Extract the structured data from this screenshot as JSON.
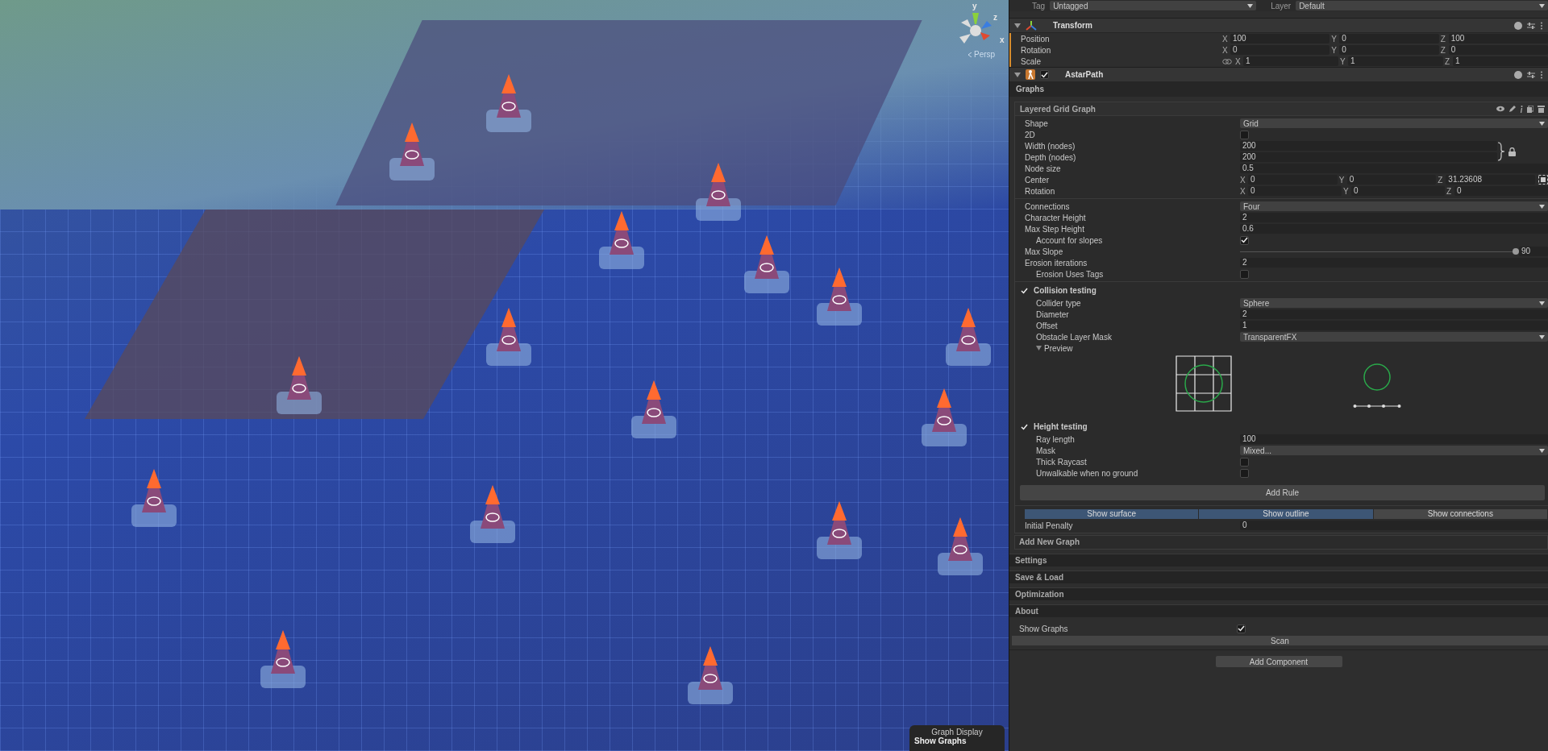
{
  "scene": {
    "gizmo": {
      "axes": [
        {
          "label": "y"
        },
        {
          "label": "z"
        },
        {
          "label": "x"
        }
      ],
      "projection": "Persp"
    },
    "overlay": {
      "title": "Graph Display",
      "item": "Show Graphs"
    }
  },
  "inspector": {
    "tag": {
      "label": "Tag",
      "value": "Untagged"
    },
    "layer": {
      "label": "Layer",
      "value": "Default"
    },
    "transform": {
      "title": "Transform",
      "expanded": true,
      "rows": [
        {
          "label": "Position",
          "fields": [
            {
              "axis": "X",
              "value": "100"
            },
            {
              "axis": "Y",
              "value": "0"
            },
            {
              "axis": "Z",
              "value": "100"
            }
          ]
        },
        {
          "label": "Rotation",
          "fields": [
            {
              "axis": "X",
              "value": "0"
            },
            {
              "axis": "Y",
              "value": "0"
            },
            {
              "axis": "Z",
              "value": "0"
            }
          ]
        },
        {
          "label": "Scale",
          "fields": [
            {
              "axis": "X",
              "value": "1"
            },
            {
              "axis": "Y",
              "value": "1"
            },
            {
              "axis": "Z",
              "value": "1"
            }
          ]
        }
      ]
    },
    "astar": {
      "title": "AstarPath",
      "enabled": true,
      "expanded": true,
      "section": "Graphs",
      "graph": {
        "title": "Layered Grid Graph",
        "groups": [
          {
            "rows": [
              {
                "kind": "dropdown",
                "label": "Shape",
                "value": "Grid"
              },
              {
                "kind": "checkbox",
                "label": "2D",
                "checked": false
              },
              {
                "kind": "pair",
                "rows": [
                  {
                    "label": "Width (nodes)",
                    "value": "200"
                  },
                  {
                    "label": "Depth (nodes)",
                    "value": "200"
                  }
                ]
              },
              {
                "kind": "field",
                "label": "Node size",
                "value": "0.5"
              },
              {
                "kind": "vector_snap",
                "label": "Center",
                "fields": [
                  {
                    "axis": "X",
                    "value": "0"
                  },
                  {
                    "axis": "Y",
                    "value": "0"
                  },
                  {
                    "axis": "Z",
                    "value": "31.23608"
                  }
                ]
              },
              {
                "kind": "vector",
                "label": "Rotation",
                "fields": [
                  {
                    "axis": "X",
                    "value": "0"
                  },
                  {
                    "axis": "Y",
                    "value": "0"
                  },
                  {
                    "axis": "Z",
                    "value": "0"
                  }
                ]
              }
            ]
          },
          {
            "rows": [
              {
                "kind": "dropdown",
                "label": "Connections",
                "value": "Four"
              },
              {
                "kind": "field",
                "label": "Character Height",
                "value": "2"
              },
              {
                "kind": "field",
                "label": "Max Step Height",
                "value": "0.6",
                "children": [
                  {
                    "kind": "checkbox",
                    "label": "Account for slopes",
                    "checked": true
                  }
                ]
              },
              {
                "kind": "slider",
                "label": "Max Slope",
                "level": 1,
                "value": "90"
              },
              {
                "kind": "field",
                "label": "Erosion iterations",
                "value": "2",
                "children": [
                  {
                    "kind": "checkbox",
                    "label": "Erosion Uses Tags",
                    "checked": false
                  }
                ]
              }
            ]
          },
          {
            "rows": [
              {
                "kind": "section",
                "label": "Collision testing",
                "checked": true,
                "children": [
                  {
                    "kind": "dropdown",
                    "label": "Collider type",
                    "value": "Sphere"
                  },
                  {
                    "kind": "field",
                    "label": "Diameter",
                    "value": "2"
                  },
                  {
                    "kind": "field",
                    "label": "Offset",
                    "value": "1"
                  },
                  {
                    "kind": "dropdown",
                    "label": "Obstacle Layer Mask",
                    "value": "TransparentFX"
                  },
                  {
                    "kind": "preview",
                    "label": "Preview",
                    "expanded": true
                  }
                ]
              },
              {
                "kind": "section",
                "label": "Height testing",
                "checked": true,
                "children": [
                  {
                    "kind": "field",
                    "label": "Ray length",
                    "value": "100"
                  },
                  {
                    "kind": "dropdown",
                    "label": "Mask",
                    "value": "Mixed..."
                  },
                  {
                    "kind": "checkbox",
                    "label": "Thick Raycast",
                    "checked": false
                  },
                  {
                    "kind": "checkbox",
                    "label": "Unwalkable when no ground",
                    "checked": false
                  }
                ]
              },
              {
                "kind": "button",
                "label": "Add Rule"
              }
            ]
          },
          {
            "rows": [
              {
                "kind": "toggles",
                "items": [
                  {
                    "label": "Show surface",
                    "selected": true
                  },
                  {
                    "label": "Show outline",
                    "selected": true
                  },
                  {
                    "label": "Show connections",
                    "selected": false
                  }
                ]
              },
              {
                "kind": "field",
                "label": "Initial Penalty",
                "value": "0"
              }
            ]
          }
        ]
      },
      "add_graph": "Add New Graph",
      "panels": [
        {
          "title": "Settings"
        },
        {
          "title": "Save & Load"
        },
        {
          "title": "Optimization"
        },
        {
          "title": "About"
        }
      ],
      "show_graphs": {
        "label": "Show Graphs",
        "checked": true
      },
      "scan": "Scan"
    },
    "add_component": "Add Component"
  }
}
